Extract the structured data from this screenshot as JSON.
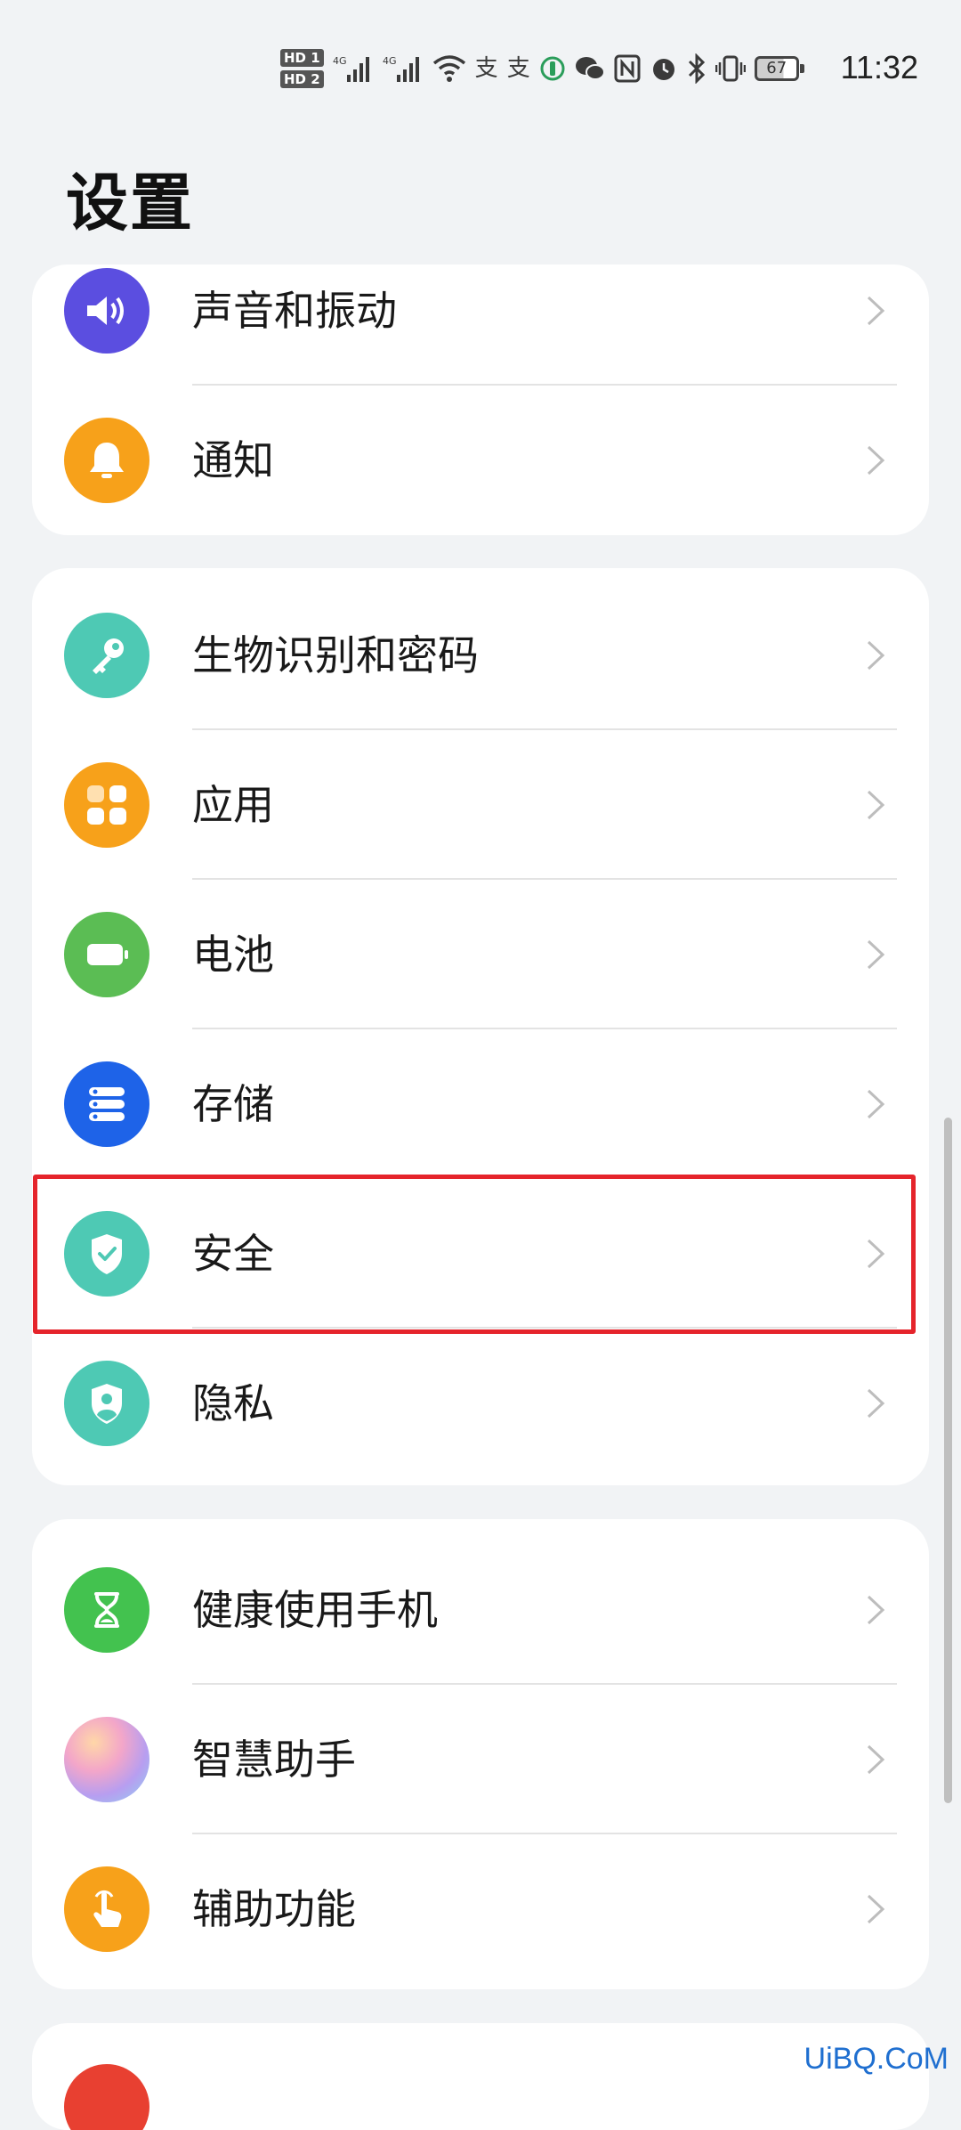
{
  "status_bar": {
    "hd1": "HD 1",
    "hd2": "HD 2",
    "net1": "4G",
    "net2": "4G",
    "battery_level": "67",
    "time": "11:32"
  },
  "page_title": "设置",
  "groups": [
    {
      "items": [
        {
          "label": "声音和振动",
          "icon": "speaker-icon",
          "color": "#5b4ee0"
        },
        {
          "label": "通知",
          "icon": "bell-icon",
          "color": "#f7a11a"
        }
      ]
    },
    {
      "items": [
        {
          "label": "生物识别和密码",
          "icon": "key-icon",
          "color": "#4ec9b4"
        },
        {
          "label": "应用",
          "icon": "apps-grid-icon",
          "color": "#f7a11a"
        },
        {
          "label": "电池",
          "icon": "battery-icon",
          "color": "#5bbd54"
        },
        {
          "label": "存储",
          "icon": "storage-icon",
          "color": "#1e63e8"
        },
        {
          "label": "安全",
          "icon": "shield-check-icon",
          "color": "#4ec9b4"
        },
        {
          "label": "隐私",
          "icon": "privacy-shield-icon",
          "color": "#4ec9b4"
        }
      ]
    },
    {
      "items": [
        {
          "label": "健康使用手机",
          "icon": "hourglass-icon",
          "color": "#43c24f"
        },
        {
          "label": "智慧助手",
          "icon": "assistant-orb-icon",
          "color": "#c98ad8"
        },
        {
          "label": "辅助功能",
          "icon": "hand-touch-icon",
          "color": "#f7a11a"
        }
      ]
    }
  ],
  "watermark": "UiBQ.CoM"
}
